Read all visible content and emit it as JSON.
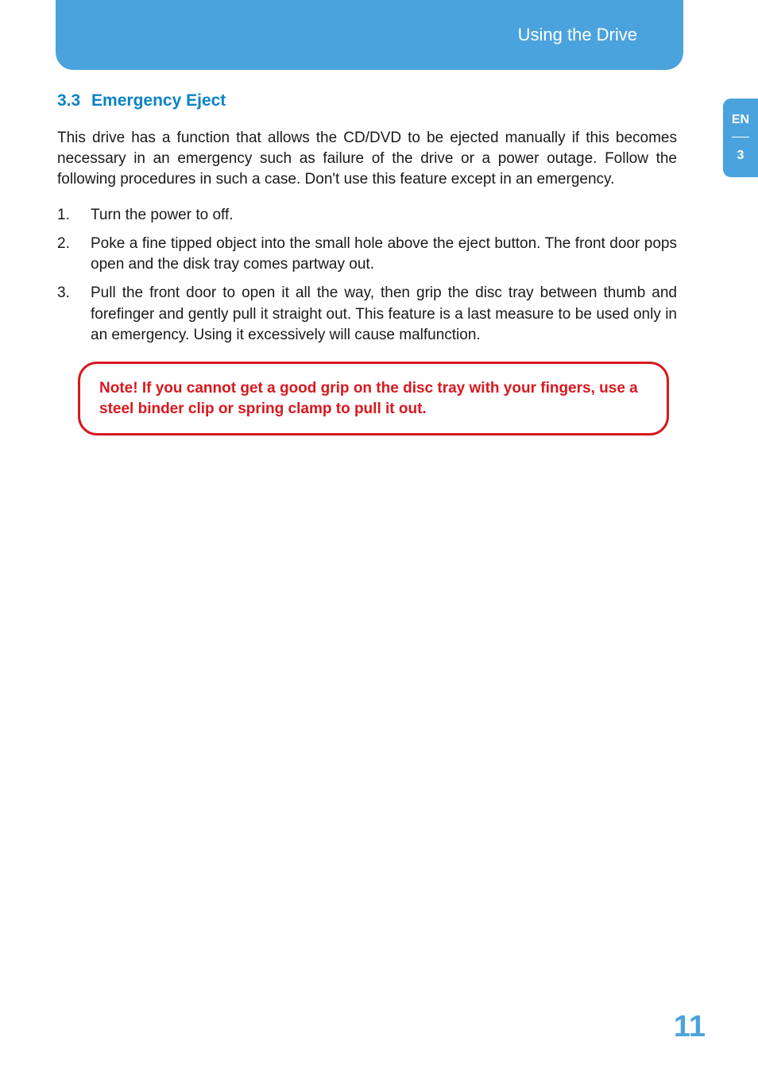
{
  "header": {
    "title": "Using the Drive"
  },
  "sideTab": {
    "lang": "EN",
    "chapter": "3"
  },
  "section": {
    "number": "3.3",
    "title": "Emergency Eject"
  },
  "intro": "This drive has a function that allows the CD/DVD to be ejected manually if this becomes necessary in an emergency such as failure of the drive or a power outage. Follow the following procedures in such a case. Don't use this feature except in an emergency.",
  "steps": [
    {
      "index": "1.",
      "text": "Turn the power to off."
    },
    {
      "index": "2.",
      "text": "Poke a fine tipped object into the small hole above the eject button. The front door pops open and the disk tray comes partway out."
    },
    {
      "index": "3.",
      "text": "Pull the front door to open it all the way, then grip the disc tray between thumb and forefinger and gently pull it straight out. This feature is a last measure to be used only in an emergency. Using it excessively will cause malfunction."
    }
  ],
  "note": "Note! If you cannot get a good grip on the disc tray with your fingers, use a steel binder clip or spring clamp to pull it out.",
  "pageNumber": "11"
}
